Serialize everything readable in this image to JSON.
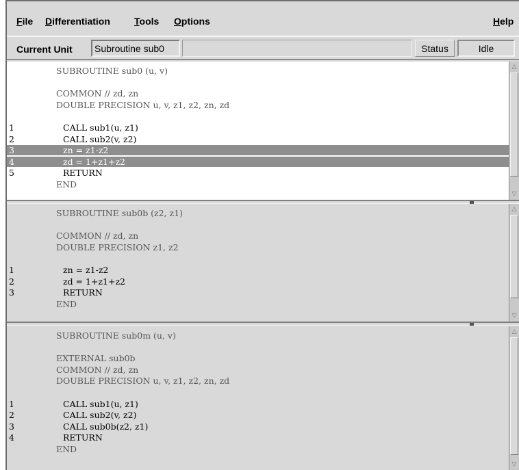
{
  "menubar": {
    "items": [
      {
        "label": "File",
        "mnemonic": "F",
        "rest": "ile"
      },
      {
        "label": "Differentiation",
        "mnemonic": "D",
        "rest": "ifferentiation"
      },
      {
        "label": "Tools",
        "mnemonic": "T",
        "rest": "ools"
      },
      {
        "label": "Options",
        "mnemonic": "O",
        "rest": "ptions"
      }
    ],
    "help": {
      "label": "Help",
      "mnemonic": "H",
      "rest": "elp"
    }
  },
  "unitbar": {
    "current_unit_label": "Current Unit",
    "current_unit_value": "Subroutine sub0",
    "status_label": "Status",
    "status_value": "Idle"
  },
  "panes": [
    {
      "lines": [
        {
          "num": "",
          "text": "SUBROUTINE sub0 (u, v)",
          "kind": "decl"
        },
        {
          "num": "",
          "text": "",
          "kind": "decl"
        },
        {
          "num": "",
          "text": "COMMON // zd, zn",
          "kind": "decl"
        },
        {
          "num": "",
          "text": "DOUBLE PRECISION u, v, z1, z2, zn, zd",
          "kind": "decl"
        },
        {
          "num": "",
          "text": "",
          "kind": "decl"
        },
        {
          "num": "1",
          "text": "CALL sub1(u, z1)",
          "kind": "stmt"
        },
        {
          "num": "2",
          "text": "CALL sub2(v, z2)",
          "kind": "stmt"
        },
        {
          "num": "3",
          "text": "zn = z1-z2",
          "kind": "stmt",
          "highlight": true
        },
        {
          "num": "4",
          "text": "zd = 1+z1+z2",
          "kind": "stmt",
          "highlight": true
        },
        {
          "num": "5",
          "text": "RETURN",
          "kind": "stmt"
        },
        {
          "num": "",
          "text": "END",
          "kind": "decl"
        }
      ]
    },
    {
      "lines": [
        {
          "num": "",
          "text": "SUBROUTINE sub0b (z2, z1)",
          "kind": "decl"
        },
        {
          "num": "",
          "text": "",
          "kind": "decl"
        },
        {
          "num": "",
          "text": "COMMON // zd, zn",
          "kind": "decl"
        },
        {
          "num": "",
          "text": "DOUBLE PRECISION z1, z2",
          "kind": "decl"
        },
        {
          "num": "",
          "text": "",
          "kind": "decl"
        },
        {
          "num": "1",
          "text": "zn = z1-z2",
          "kind": "stmt"
        },
        {
          "num": "2",
          "text": "zd = 1+z1+z2",
          "kind": "stmt"
        },
        {
          "num": "3",
          "text": "RETURN",
          "kind": "stmt"
        },
        {
          "num": "",
          "text": "END",
          "kind": "decl"
        }
      ]
    },
    {
      "lines": [
        {
          "num": "",
          "text": "SUBROUTINE sub0m (u, v)",
          "kind": "decl"
        },
        {
          "num": "",
          "text": "",
          "kind": "decl"
        },
        {
          "num": "",
          "text": "EXTERNAL sub0b",
          "kind": "decl"
        },
        {
          "num": "",
          "text": "COMMON // zd, zn",
          "kind": "decl"
        },
        {
          "num": "",
          "text": "DOUBLE PRECISION u, v, z1, z2, zn, zd",
          "kind": "decl"
        },
        {
          "num": "",
          "text": "",
          "kind": "decl"
        },
        {
          "num": "1",
          "text": "CALL sub1(u, z1)",
          "kind": "stmt"
        },
        {
          "num": "2",
          "text": "CALL sub2(v, z2)",
          "kind": "stmt"
        },
        {
          "num": "3",
          "text": "CALL sub0b(z2, z1)",
          "kind": "stmt"
        },
        {
          "num": "4",
          "text": "RETURN",
          "kind": "stmt"
        },
        {
          "num": "",
          "text": "END",
          "kind": "decl"
        }
      ]
    }
  ],
  "icons": {
    "scroll_up": "scroll-up-arrow-icon",
    "scroll_down": "scroll-down-arrow-icon"
  },
  "colors": {
    "highlight": "#8e8e8e",
    "background": "#d9d9d9",
    "active_pane": "#ffffff"
  }
}
